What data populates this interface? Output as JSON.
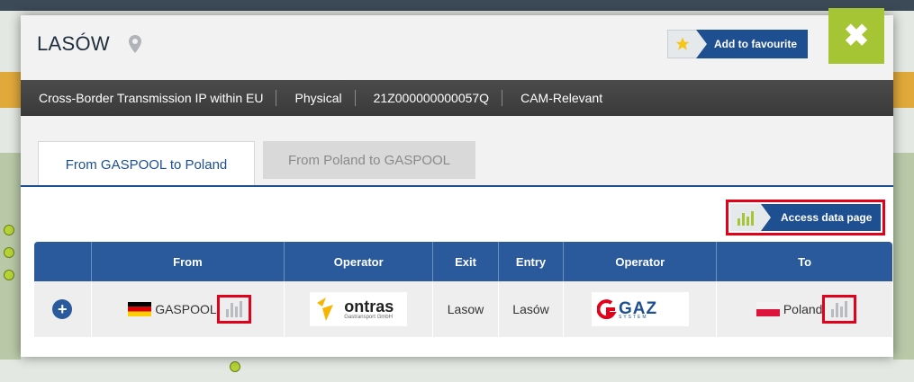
{
  "modal": {
    "title": "LASÓW",
    "favourite_label": "Add to favourite",
    "close_label": "✖"
  },
  "info_bar": {
    "items": [
      "Cross-Border Transmission IP within EU",
      "Physical",
      "21Z000000000057Q",
      "CAM-Relevant"
    ]
  },
  "tabs": [
    {
      "label": "From GASPOOL to Poland",
      "active": true
    },
    {
      "label": "From Poland to GASPOOL",
      "active": false
    }
  ],
  "access_data_label": "Access data page",
  "table": {
    "headers": [
      "",
      "From",
      "Operator",
      "Exit",
      "Entry",
      "Operator",
      "To"
    ],
    "rows": [
      {
        "expand": "+",
        "from": "GASPOOL",
        "from_operator_logo_text": "ontras",
        "from_operator_logo_subtext": "Gastransport GmbH",
        "exit": "Lasow",
        "entry": "Lasów",
        "to_operator_logo_text": "GAZ-SYSTEM",
        "to": "Poland"
      }
    ]
  },
  "colors": {
    "accent_blue": "#1d4f91",
    "close_green": "#a6c535",
    "highlight_red": "#e3001b",
    "header_dark": "#3a3a3a"
  }
}
